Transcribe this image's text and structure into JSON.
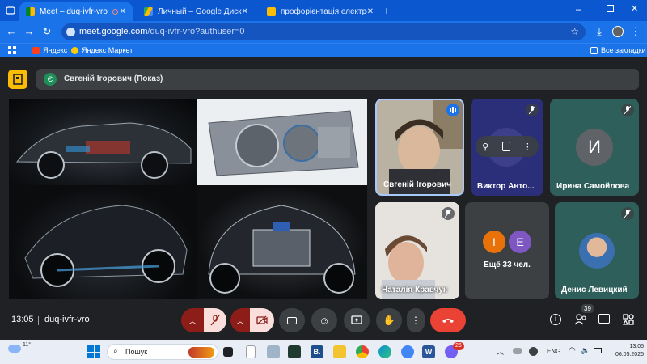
{
  "browser": {
    "tabs": [
      {
        "label": "Meet – duq-ivfr-vro",
        "active": true
      },
      {
        "label": "Личный – Google Диск",
        "active": false
      },
      {
        "label": "профорієнтація електрозвар...",
        "active": false
      }
    ],
    "url_host": "meet.google.com",
    "url_path": "/duq-ivfr-vro?authuser=0",
    "bookmarks": [
      "Яндекс",
      "Яндекс Маркет"
    ],
    "all_bookmarks": "Все закладки",
    "accent": "#1a73e8"
  },
  "meet": {
    "presenter_initial": "Є",
    "presenter_label": "Євгеній Ігорович (Показ)",
    "participants": [
      {
        "name": "Євгеній Ігорович",
        "tile": "video"
      },
      {
        "name": "Виктор Анто...",
        "tile": "avatar"
      },
      {
        "name": "Ирина Самойлова",
        "tile": "letter",
        "letter": "И"
      },
      {
        "name": "Наталія Кравчук",
        "tile": "video"
      },
      {
        "name": "Денис Левицкий",
        "tile": "photo"
      }
    ],
    "others": {
      "letters": [
        "I",
        "E"
      ],
      "label": "Ещё 33 чел."
    },
    "time": "13:05",
    "meeting_code": "duq-ivfr-vro",
    "participant_count": "39"
  },
  "taskbar": {
    "weather": "11°",
    "search_placeholder": "Пошук",
    "language": "ENG",
    "clock_time": "13:05",
    "clock_date": "06.05.2025",
    "badge": "26"
  }
}
